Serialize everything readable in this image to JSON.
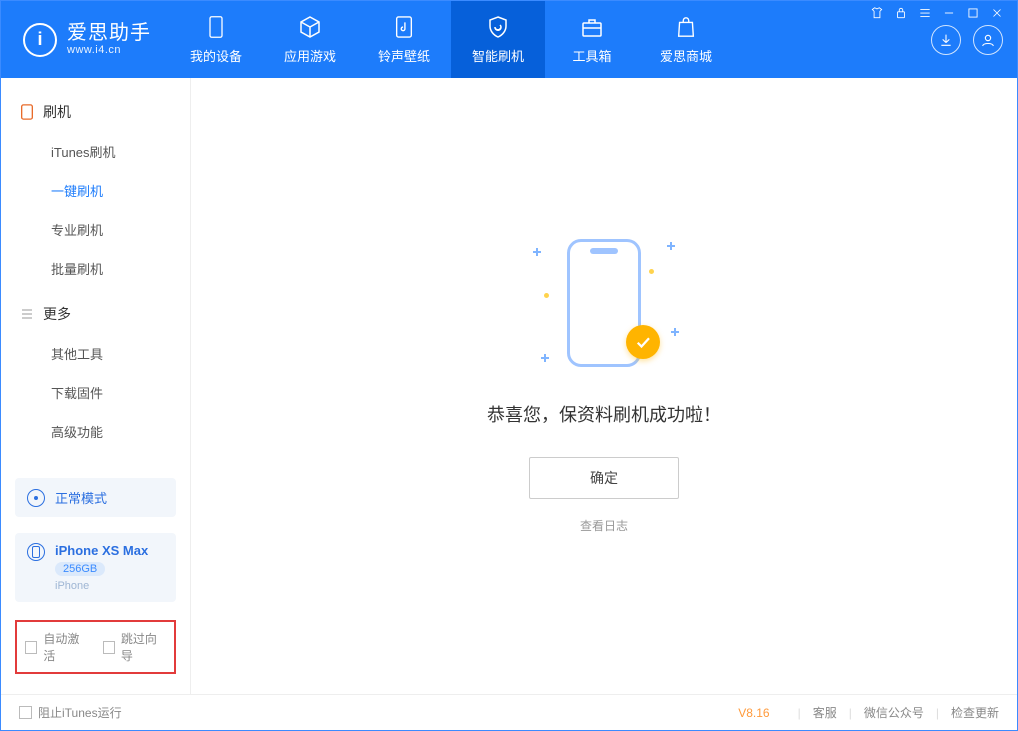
{
  "brand": {
    "cn": "爱思助手",
    "en": "www.i4.cn",
    "logo_letter": "i"
  },
  "tabs": {
    "device": "我的设备",
    "apps": "应用游戏",
    "ring": "铃声壁纸",
    "flash": "智能刷机",
    "tools": "工具箱",
    "store": "爱思商城"
  },
  "sidebar": {
    "group_flash": "刷机",
    "items_flash": {
      "itunes": "iTunes刷机",
      "onekey": "一键刷机",
      "pro": "专业刷机",
      "batch": "批量刷机"
    },
    "group_more": "更多",
    "items_more": {
      "other": "其他工具",
      "download": "下载固件",
      "adv": "高级功能"
    },
    "mode_label": "正常模式",
    "device": {
      "name": "iPhone XS Max",
      "capacity": "256GB",
      "type": "iPhone"
    },
    "checks": {
      "auto": "自动激活",
      "skip": "跳过向导"
    }
  },
  "main": {
    "success": "恭喜您，保资料刷机成功啦！",
    "ok": "确定",
    "log": "查看日志"
  },
  "footer": {
    "block_itunes": "阻止iTunes运行",
    "version": "V8.16",
    "service": "客服",
    "wechat": "微信公众号",
    "update": "检查更新"
  }
}
